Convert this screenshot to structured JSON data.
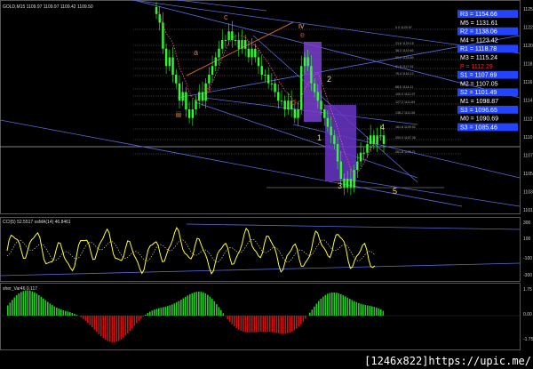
{
  "header": {
    "symbol": "GOLD,M15",
    "ohlc": "1109.97 1109.97 1109.42 1109.50"
  },
  "main": {
    "y_axis_labels": [
      "1125",
      "1122",
      "1120",
      "1118",
      "1116",
      "1114",
      "1112",
      "1110",
      "1107",
      "1105",
      "1103",
      "1101"
    ],
    "wave_labels": {
      "iii": "iii",
      "a": "a",
      "b": "b",
      "c": "c",
      "iv": "iv",
      "d": "d",
      "e": "e",
      "w1": "1",
      "w2": "2",
      "w3": "3",
      "w4": "4",
      "w5": "5"
    },
    "fib_labels": [
      "0.0 1120.97",
      "23.6 1120.15",
      "38.2 1119.46",
      "50.0 1118.89",
      "61.8 1117.51",
      "76.4 1116.13",
      "88.6 1114.11",
      "100.0 1112.97",
      "127.2 1111.69",
      "138.2 1111.06",
      "161.8 1109.92",
      "200.0 1107.36",
      "261.8 1105.21"
    ],
    "pivots": [
      {
        "name": "R3",
        "value": "1154.66",
        "color": "#2244ff",
        "style": "fill"
      },
      {
        "name": "M5",
        "value": "1131.61",
        "color": "#ffffff",
        "style": "text"
      },
      {
        "name": "R2",
        "value": "1138.06",
        "color": "#2244ff",
        "style": "fill"
      },
      {
        "name": "M4",
        "value": "1123.42",
        "color": "#ffffff",
        "style": "text"
      },
      {
        "name": "R1",
        "value": "1118.78",
        "color": "#2244ff",
        "style": "fill"
      },
      {
        "name": "M3",
        "value": "1115.24",
        "color": "#ffffff",
        "style": "text"
      },
      {
        "name": "P",
        "value": "1112.29",
        "color": "#ff2222",
        "style": "text"
      },
      {
        "name": "S1",
        "value": "1107.69",
        "color": "#2244ff",
        "style": "fill"
      },
      {
        "name": "M2",
        "value": "1107.05",
        "color": "#ffffff",
        "style": "text"
      },
      {
        "name": "S2",
        "value": "1101.49",
        "color": "#2244ff",
        "style": "fill"
      },
      {
        "name": "M1",
        "value": "1098.87",
        "color": "#ffffff",
        "style": "text"
      },
      {
        "name": "S3",
        "value": "1096.65",
        "color": "#2244ff",
        "style": "fill"
      },
      {
        "name": "M0",
        "value": "1090.69",
        "color": "#ffffff",
        "style": "text"
      },
      {
        "name": "S3",
        "value": "1085.46",
        "color": "#2244ff",
        "style": "fill"
      }
    ]
  },
  "osc": {
    "title": "CCI(5) 52.5517  osMA(14) 46.8461",
    "y_labels": [
      "300",
      "100",
      "-100",
      "-300"
    ],
    "color": "#ffff33"
  },
  "hist": {
    "title": "sher_Var46 0.117",
    "y_labels": [
      "1.75",
      "0.00",
      "-1.75"
    ],
    "pos_color": "#22cc22",
    "neg_color": "#cc1111"
  },
  "footer": {
    "text": "[1246x822]https://upic.me/"
  },
  "chart_data": {
    "type": "line",
    "title": "GOLD,M15",
    "close": [
      1124,
      1123,
      1120,
      1118,
      1119,
      1117,
      1116,
      1114,
      1115,
      1113,
      1112,
      1113,
      1114,
      1115,
      1114,
      1116,
      1117,
      1118,
      1119,
      1120,
      1121,
      1121,
      1122,
      1121,
      1121,
      1120,
      1121,
      1120,
      1119,
      1120,
      1119,
      1118,
      1117,
      1117,
      1116,
      1116,
      1115,
      1114,
      1114,
      1113,
      1114,
      1113,
      1112,
      1113,
      1118,
      1119,
      1118,
      1116,
      1115,
      1114,
      1113,
      1112,
      1111,
      1110,
      1109,
      1107,
      1105,
      1104,
      1105,
      1104,
      1106,
      1107,
      1108,
      1108,
      1109,
      1110,
      1109,
      1110,
      1110,
      1109
    ],
    "ylim": [
      1101,
      1125
    ]
  }
}
